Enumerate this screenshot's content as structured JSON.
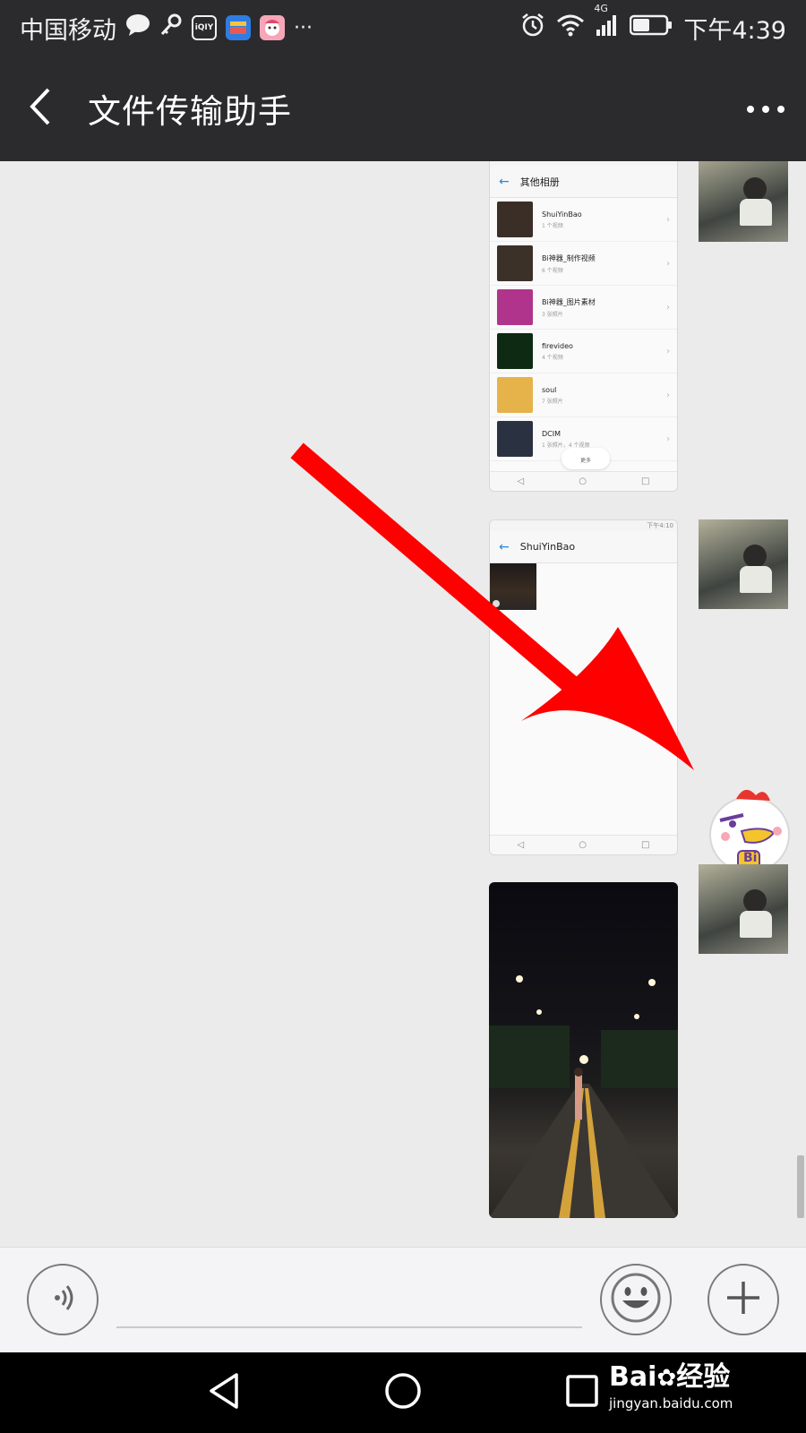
{
  "status_bar": {
    "carrier": "中国移动",
    "network": "4G",
    "time": "下午4:39",
    "app_icons": [
      "chat-bubble-icon",
      "key-icon",
      "iqiyi-icon",
      "wallet-app-icon",
      "cartoon-app-icon",
      "more-notifications-icon"
    ],
    "system_icons": [
      "alarm-icon",
      "wifi-icon",
      "signal-icon",
      "battery-icon"
    ],
    "iqiyi_label": "iQIY",
    "more_dots": "···"
  },
  "header": {
    "title": "文件传输助手",
    "back_icon": "chevron-left-icon",
    "more_icon": "more-dots-icon"
  },
  "messages": [
    {
      "type": "image",
      "sender": "me",
      "screen_title": "其他相册",
      "albums": [
        {
          "name": "ShuiYinBao",
          "count": "1 个视频",
          "color": "#3a2e26"
        },
        {
          "name": "Bi神器_制作视频",
          "count": "6 个视频",
          "color": "#3b3129"
        },
        {
          "name": "Bi神器_图片素材",
          "count": "3 张照片",
          "color": "#b0348b"
        },
        {
          "name": "firevideo",
          "count": "4 个视频",
          "color": "#0f2a12"
        },
        {
          "name": "soul",
          "count": "7 张照片",
          "color": "#e6b24a"
        },
        {
          "name": "DCIM",
          "count": "1 张照片，4 个视频",
          "color": "#2a3140"
        }
      ],
      "more_label": "更多"
    },
    {
      "type": "image",
      "sender": "me",
      "screen_title": "ShuiYinBao",
      "mini_time": "下午4:10"
    },
    {
      "type": "image",
      "sender": "me",
      "description_visible": false
    }
  ],
  "sticker": {
    "label": "Bi"
  },
  "input_bar": {
    "voice_icon": "voice-icon",
    "emoji_icon": "emoji-icon",
    "plus_icon": "plus-icon",
    "placeholder": ""
  },
  "nav_bar": {
    "back_icon": "nav-back-icon",
    "home_icon": "nav-home-icon",
    "recents_icon": "nav-recents-icon"
  },
  "watermark": {
    "brand": "Bai",
    "brand_cn": "经验",
    "url": "jingyan.baidu.com"
  },
  "colors": {
    "bar_bg": "#2b2b2d",
    "chat_bg": "#ebebeb",
    "arrow": "#ff0000"
  }
}
